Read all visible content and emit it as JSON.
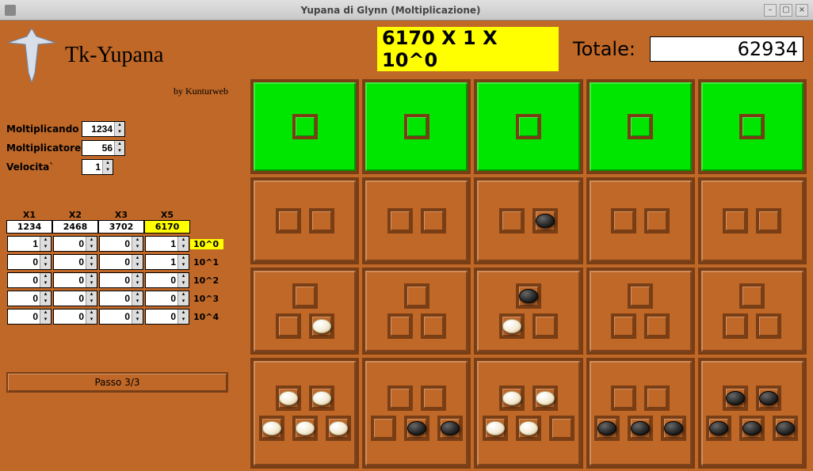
{
  "window": {
    "title": "Yupana di Glynn (Moltiplicazione)"
  },
  "logo": {
    "title": "Tk-Yupana",
    "subtitle": "by Kunturweb"
  },
  "inputs": {
    "moltiplicando_label": "Moltiplicando",
    "moltiplicando": "1234",
    "moltiplicatore_label": "Moltiplicatore",
    "moltiplicatore": "56",
    "velocita_label": "Velocita`",
    "velocita": "1"
  },
  "cols": {
    "x1": "X1",
    "x2": "X2",
    "x3": "X3",
    "x5": "X5"
  },
  "mults": {
    "x1": "1234",
    "x2": "2468",
    "x3": "3702",
    "x5": "6170",
    "x5_highlight": true
  },
  "gridrows": [
    {
      "label": "10^0",
      "hl": true,
      "v": [
        "1",
        "0",
        "0",
        "1"
      ]
    },
    {
      "label": "10^1",
      "hl": false,
      "v": [
        "0",
        "0",
        "0",
        "1"
      ]
    },
    {
      "label": "10^2",
      "hl": false,
      "v": [
        "0",
        "0",
        "0",
        "0"
      ]
    },
    {
      "label": "10^3",
      "hl": false,
      "v": [
        "0",
        "0",
        "0",
        "0"
      ]
    },
    {
      "label": "10^4",
      "hl": false,
      "v": [
        "0",
        "0",
        "0",
        "0"
      ]
    }
  ],
  "passo": "Passo 3/3",
  "top": {
    "expression": "6170 X 1 X 10^0",
    "totale_label": "Totale:",
    "totale_value": "62934"
  },
  "board": [
    [
      {
        "green": true,
        "rows": [
          [
            null
          ]
        ]
      },
      {
        "green": true,
        "rows": [
          [
            null
          ]
        ]
      },
      {
        "green": true,
        "rows": [
          [
            null
          ]
        ]
      },
      {
        "green": true,
        "rows": [
          [
            null
          ]
        ]
      },
      {
        "green": true,
        "rows": [
          [
            null
          ]
        ]
      }
    ],
    [
      {
        "rows": [
          [
            null,
            null
          ]
        ]
      },
      {
        "rows": [
          [
            null,
            null
          ]
        ]
      },
      {
        "rows": [
          [
            null,
            "b"
          ]
        ]
      },
      {
        "rows": [
          [
            null,
            null
          ]
        ]
      },
      {
        "rows": [
          [
            null,
            null
          ]
        ]
      }
    ],
    [
      {
        "rows": [
          [
            null
          ],
          [
            null,
            "w"
          ]
        ]
      },
      {
        "rows": [
          [
            null
          ],
          [
            null,
            null
          ]
        ]
      },
      {
        "rows": [
          [
            "b"
          ],
          [
            "w",
            null
          ]
        ]
      },
      {
        "rows": [
          [
            null
          ],
          [
            null,
            null
          ]
        ]
      },
      {
        "rows": [
          [
            null
          ],
          [
            null,
            null
          ]
        ]
      }
    ],
    [
      {
        "rows": [
          [
            "w",
            "w"
          ],
          [
            "w",
            "w",
            "w"
          ]
        ]
      },
      {
        "rows": [
          [
            null,
            null
          ],
          [
            null,
            "b",
            "b"
          ]
        ]
      },
      {
        "rows": [
          [
            "w",
            "w"
          ],
          [
            "w",
            "w",
            null
          ]
        ]
      },
      {
        "rows": [
          [
            null,
            null
          ],
          [
            "b",
            "b",
            "b"
          ]
        ]
      },
      {
        "rows": [
          [
            "b",
            "b"
          ],
          [
            "b",
            "b",
            "b"
          ]
        ]
      }
    ]
  ]
}
